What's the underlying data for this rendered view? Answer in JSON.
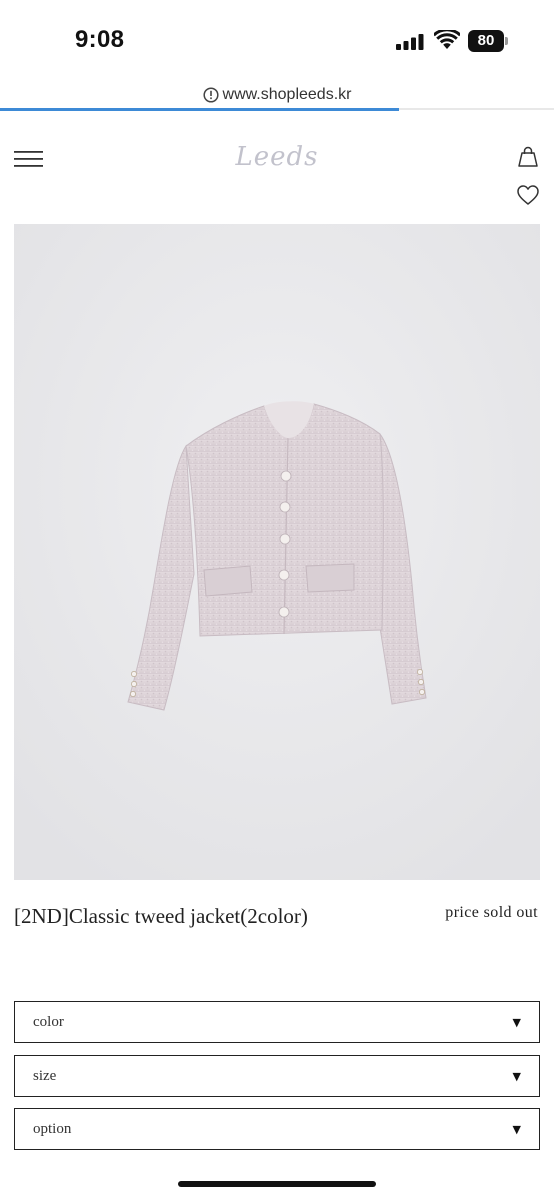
{
  "status_bar": {
    "time": "9:08",
    "battery_level": "80"
  },
  "browser": {
    "url": "www.shopleeds.kr",
    "load_progress": 0.72
  },
  "header": {
    "logo_text": "Leeds",
    "icons": [
      "menu-icon",
      "shopping-bag-icon",
      "heart-icon"
    ]
  },
  "product": {
    "name": "[2ND]Classic tweed jacket(2color)",
    "price_status": "price sold out",
    "image_subject": "lilac tweed jacket with pearl buttons"
  },
  "options": [
    {
      "label": "color"
    },
    {
      "label": "size"
    },
    {
      "label": "option"
    }
  ],
  "colors": {
    "accent_progress": "#3d8ad6",
    "logo": "#c2c2cc",
    "jacket": "#ddd3d8",
    "background_image": "#e6e6e8"
  }
}
